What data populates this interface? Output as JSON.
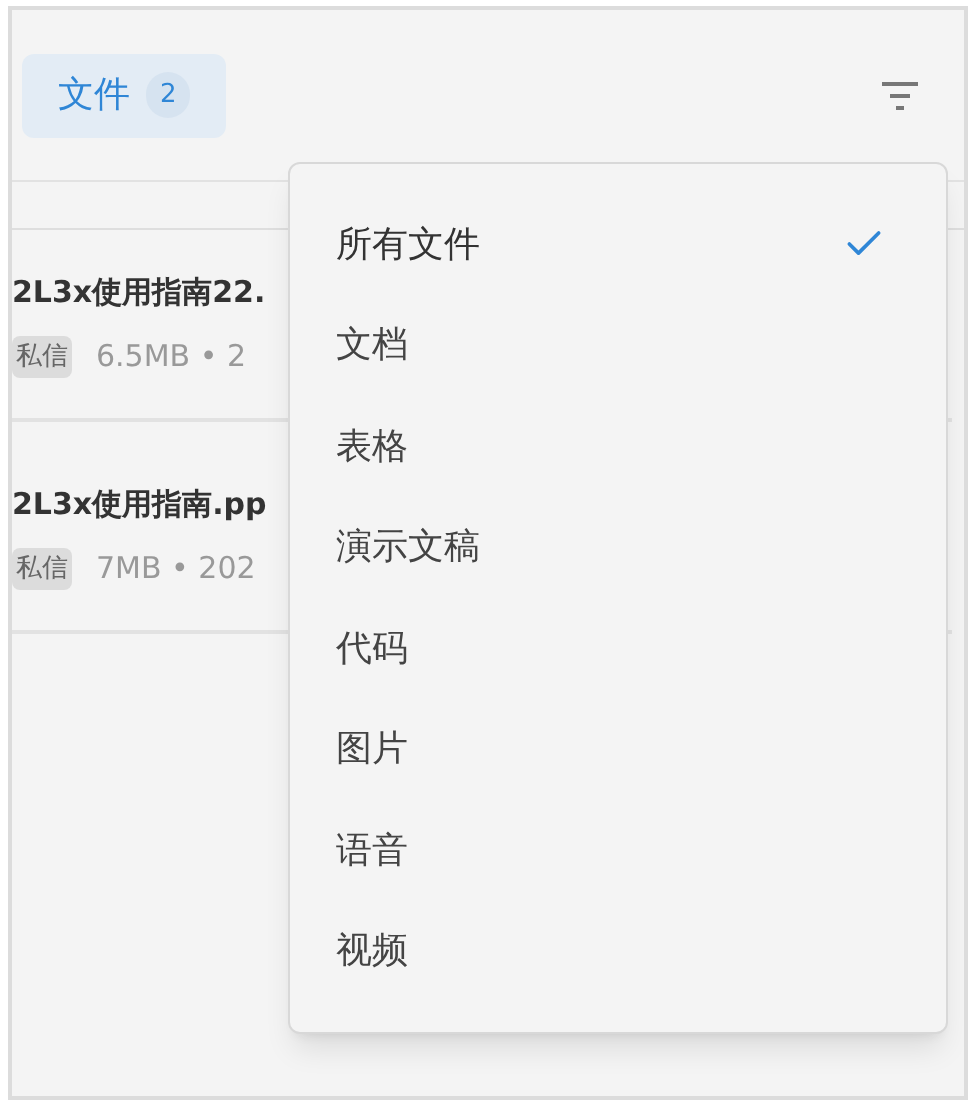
{
  "tabs": [
    {
      "label": "文件",
      "count": "2",
      "selected": true
    }
  ],
  "files": [
    {
      "name": "2L3x使用指南22.",
      "tag": "私信",
      "meta": "6.5MB • 2"
    },
    {
      "name": "2L3x使用指南.pp",
      "tag": "私信",
      "meta": "7MB • 202"
    }
  ],
  "filter_menu": {
    "items": [
      {
        "label": "所有文件",
        "selected": true
      },
      {
        "label": "文档",
        "selected": false
      },
      {
        "label": "表格",
        "selected": false
      },
      {
        "label": "演示文稿",
        "selected": false
      },
      {
        "label": "代码",
        "selected": false
      },
      {
        "label": "图片",
        "selected": false
      },
      {
        "label": "语音",
        "selected": false
      },
      {
        "label": "视频",
        "selected": false
      }
    ]
  }
}
